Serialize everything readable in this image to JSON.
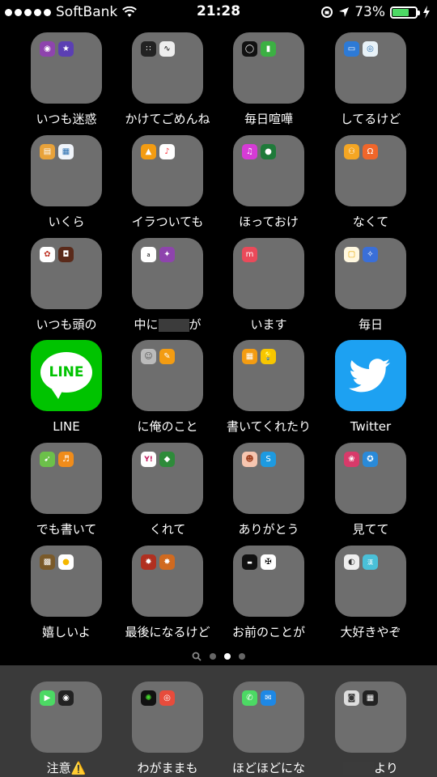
{
  "status_bar": {
    "carrier": "SoftBank",
    "time": "21:28",
    "battery_percent": "73%",
    "battery_level": 0.73,
    "battery_color": "#4cd964"
  },
  "grid": {
    "row1": [
      {
        "label": "いつも迷惑",
        "minis": [
          "podcasts-icon",
          "imovie-icon"
        ]
      },
      {
        "label": "かけてごめんね",
        "minis": [
          "camera-app-icon",
          "voice-memos-icon"
        ]
      },
      {
        "label": "毎日喧嘩",
        "minis": [
          "watch-icon",
          "numbers-icon"
        ]
      },
      {
        "label": "してるけど",
        "minis": [
          "keynote-icon",
          "find-icon"
        ]
      }
    ],
    "row2": [
      {
        "label": "いくら",
        "minis": [
          "wallet-app-icon",
          "calendar-app-icon"
        ]
      },
      {
        "label": "イラついても",
        "minis": [
          "graduation-icon",
          "music-icon"
        ]
      },
      {
        "label": "ほっておけ",
        "minis": [
          "itunes-icon",
          "find-friends-icon"
        ]
      },
      {
        "label": "なくて",
        "minis": [
          "family-icon",
          "headphones-icon"
        ]
      }
    ],
    "row3": [
      {
        "label": "いつも頭の",
        "minis": [
          "game-icon",
          "game2-icon"
        ]
      },
      {
        "label": "中に",
        "redacted_suffix": "が",
        "minis": [
          "amazon-icon",
          "game3-icon"
        ]
      },
      {
        "label": "います",
        "minis": [
          "mercari-icon"
        ]
      },
      {
        "label": "毎日",
        "minis": [
          "notes-icon",
          "game4-icon"
        ]
      }
    ],
    "row4": [
      {
        "label": "LINE",
        "type": "line",
        "wordmark": "LINE"
      },
      {
        "label": "に俺のこと",
        "minis": [
          "contacts-icon",
          "pages-icon"
        ]
      },
      {
        "label": "書いてくれたり",
        "minis": [
          "calculator-icon",
          "tips-icon"
        ]
      },
      {
        "label": "Twitter",
        "type": "twitter"
      }
    ],
    "row5": [
      {
        "label": "でも書いて",
        "minis": [
          "maps-icon",
          "garageband-icon"
        ]
      },
      {
        "label": "くれて",
        "minis": [
          "yahoo-icon",
          "game5-icon"
        ]
      },
      {
        "label": "ありがとう",
        "minis": [
          "game6-icon",
          "shazam-icon"
        ]
      },
      {
        "label": "見てて",
        "minis": [
          "game7-icon",
          "game8-icon"
        ]
      }
    ],
    "row6": [
      {
        "label": "嬉しいよ",
        "minis": [
          "minecraft-icon",
          "game9-icon"
        ]
      },
      {
        "label": "最後になるけど",
        "minis": [
          "game10-icon",
          "game11-icon"
        ]
      },
      {
        "label": "お前のことが",
        "minis": [
          "video-icon",
          "game12-icon"
        ]
      },
      {
        "label": "大好きやぞ",
        "minis": [
          "game13-icon",
          "game14-icon"
        ]
      }
    ]
  },
  "page_indicator": {
    "pages": 3,
    "active": 2
  },
  "dock": [
    {
      "label": "注意⚠️",
      "minis": [
        "facetime-icon",
        "camera-lens-icon"
      ]
    },
    {
      "label": "わがままも",
      "minis": [
        "razer-icon",
        "camera-red-icon"
      ]
    },
    {
      "label": "ほどほどにな",
      "minis": [
        "phone-icon",
        "mail-icon"
      ]
    },
    {
      "label": "より",
      "minis": [
        "camera-icon",
        "clapper-icon"
      ]
    }
  ]
}
